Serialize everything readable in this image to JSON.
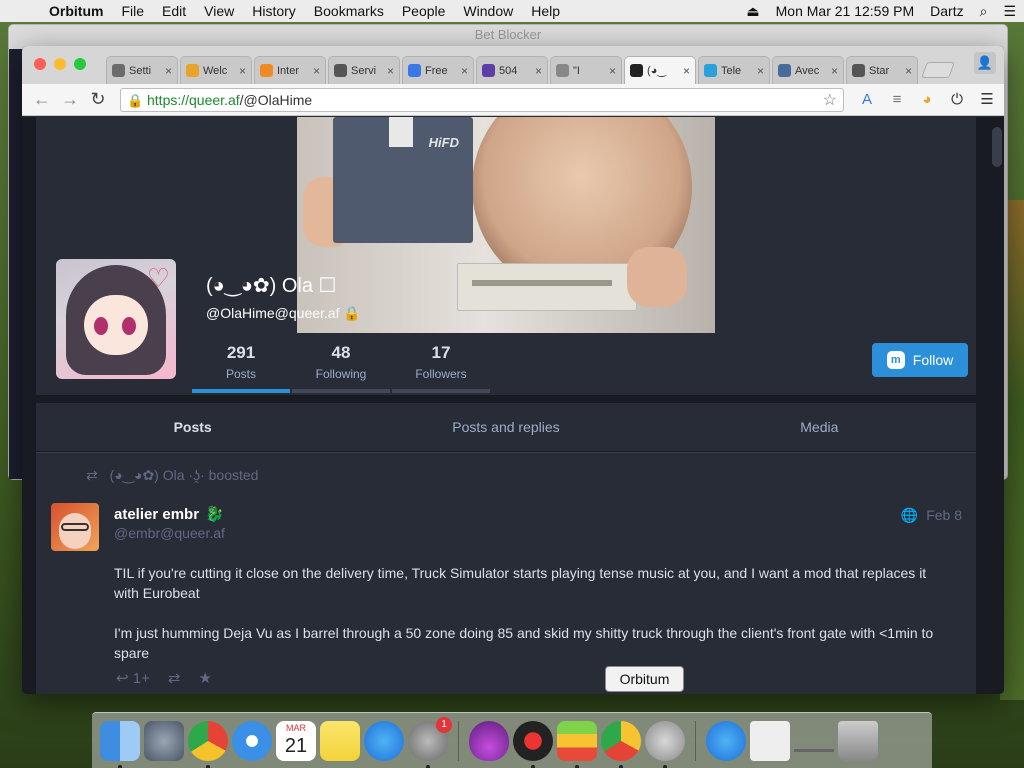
{
  "menubar": {
    "app": "Orbitum",
    "items": [
      "File",
      "Edit",
      "View",
      "History",
      "Bookmarks",
      "People",
      "Window",
      "Help"
    ],
    "clock": "Mon Mar 21  12:59 PM",
    "user": "Dartz"
  },
  "background_window": {
    "title": "Bet Blocker"
  },
  "tabs": [
    {
      "label": "Setti",
      "color": "#6b6b6b"
    },
    {
      "label": "Welc",
      "color": "#e8a32b"
    },
    {
      "label": "Inter",
      "color": "#f08a24"
    },
    {
      "label": "Servi",
      "color": "#555555"
    },
    {
      "label": "Free",
      "color": "#3b78e7"
    },
    {
      "label": "504",
      "color": "#5b3fa6"
    },
    {
      "label": "\"I",
      "color": "#888888"
    },
    {
      "label": "(◕‿",
      "color": "#222222"
    },
    {
      "label": "Tele",
      "color": "#2aa1da"
    },
    {
      "label": "Avec",
      "color": "#4a6a9a"
    },
    {
      "label": "Star",
      "color": "#555555"
    }
  ],
  "address": {
    "scheme_host": "https://queer.af",
    "path": "/@OlaHime"
  },
  "profile": {
    "display_name": "(◕‿◕✿) Ola ☐",
    "handle": "@OlaHime@queer.af",
    "header_brand": "HiFD",
    "stats": [
      {
        "value": "291",
        "label": "Posts",
        "active": true
      },
      {
        "value": "48",
        "label": "Following",
        "active": false
      },
      {
        "value": "17",
        "label": "Followers",
        "active": false
      }
    ],
    "follow_label": "Follow"
  },
  "profile_tabs": [
    "Posts",
    "Posts and replies",
    "Media"
  ],
  "status": {
    "boosted_by": "(◕‿◕✿) Ola ·ʖ̯· boosted",
    "author": "atelier embr",
    "author_handle": "@embr@queer.af",
    "date": "Feb 8",
    "paragraphs": [
      "TIL if you're cutting it close on the delivery time, Truck Simulator starts playing tense music at you, and I want a mod that replaces it with Eurobeat",
      "I'm just humming Deja Vu as I barrel through a 50 zone doing 85 and skid my shitty truck through the client's front gate with <1min to spare"
    ],
    "reply_count": "1+"
  },
  "tooltip": "Orbitum",
  "dock": {
    "calendar_month": "MAR",
    "calendar_day": "21",
    "prefs_badge": "1"
  }
}
